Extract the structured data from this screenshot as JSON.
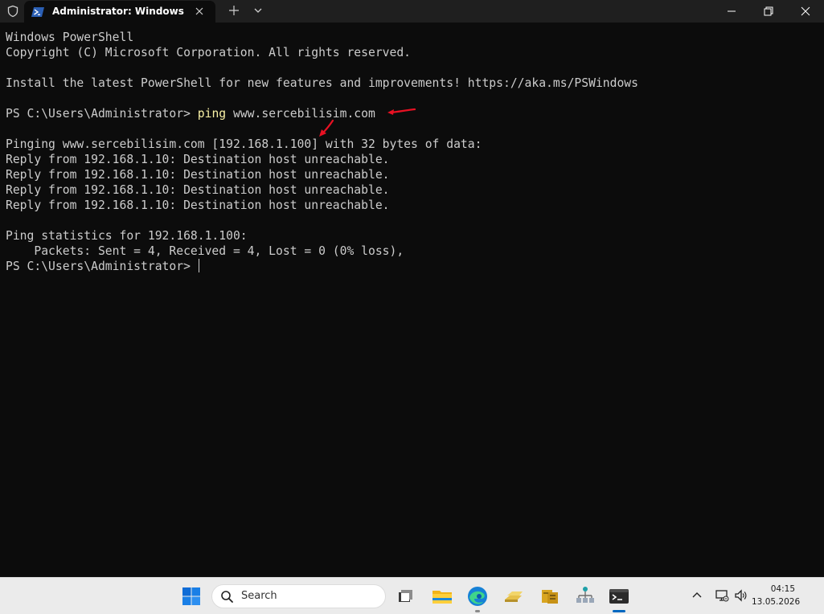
{
  "window": {
    "tab_title": "Administrator: Windows PowerShell"
  },
  "terminal": {
    "line1": "Windows PowerShell",
    "line2": "Copyright (C) Microsoft Corporation. All rights reserved.",
    "line3": "Install the latest PowerShell for new features and improvements! https://aka.ms/PSWindows",
    "prompt": "PS C:\\Users\\Administrator> ",
    "command": "ping",
    "command_arg": " www.sercebilisim.com",
    "ping_header": "Pinging www.sercebilisim.com [192.168.1.100] with 32 bytes of data:",
    "reply1": "Reply from 192.168.1.10: Destination host unreachable.",
    "reply2": "Reply from 192.168.1.10: Destination host unreachable.",
    "reply3": "Reply from 192.168.1.10: Destination host unreachable.",
    "reply4": "Reply from 192.168.1.10: Destination host unreachable.",
    "stats_header": "Ping statistics for 192.168.1.100:",
    "stats_packets": "    Packets: Sent = 4, Received = 4, Lost = 0 (0% loss),",
    "final_prompt": "PS C:\\Users\\Administrator> "
  },
  "taskbar": {
    "search_placeholder": "Search",
    "time": "04:15",
    "date": "13.05.2026",
    "icons": [
      "windows-start",
      "search",
      "task-view",
      "file-explorer",
      "edge",
      "gold-bars-app",
      "server-manager-app",
      "network-app",
      "terminal"
    ]
  },
  "colors": {
    "terminal_bg": "#0c0c0c",
    "terminal_text": "#cccccc",
    "command_text": "#f9f1a5",
    "annotation_arrow": "#e81123",
    "titlebar_bg": "#1f1f1f",
    "taskbar_bg": "#ebebeb"
  }
}
